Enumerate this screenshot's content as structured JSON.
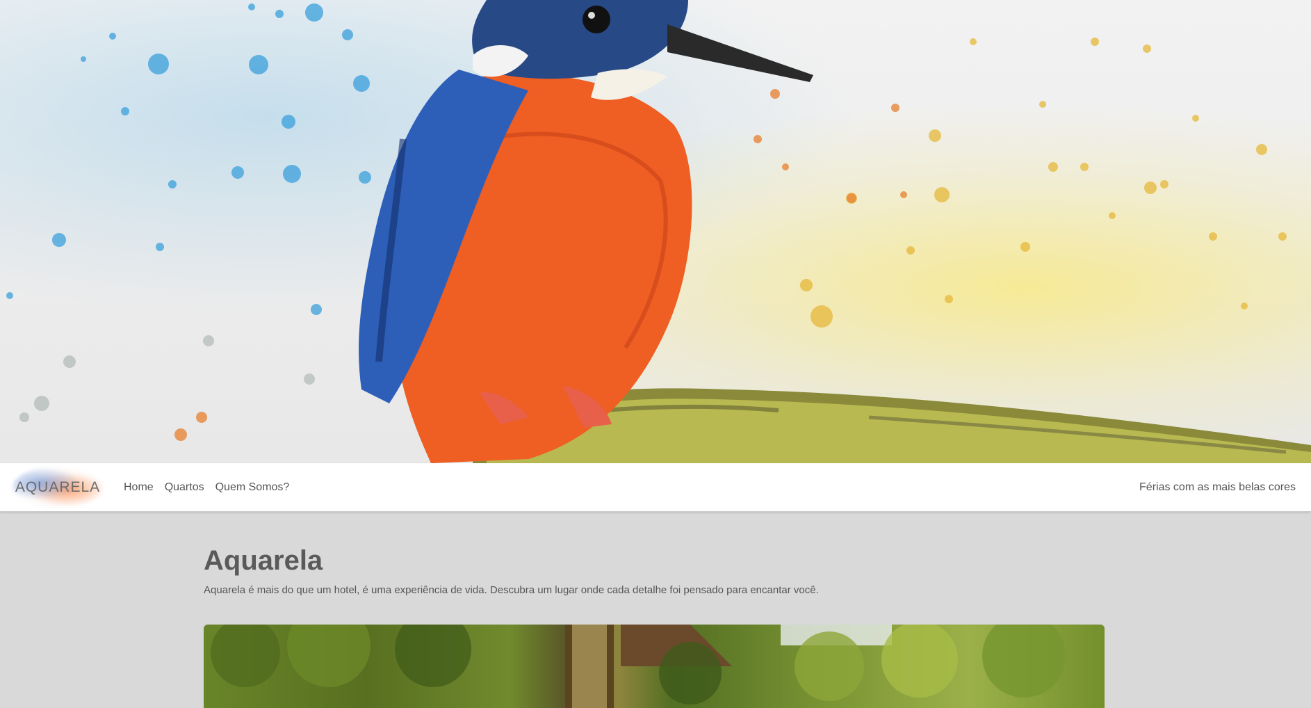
{
  "navbar": {
    "brand": "AQUARELA",
    "links": [
      {
        "label": "Home"
      },
      {
        "label": "Quartos"
      },
      {
        "label": "Quem Somos?"
      }
    ],
    "tagline": "Férias com as mais belas cores"
  },
  "main": {
    "title": "Aquarela",
    "lead": "Aquarela é mais do que um hotel, é uma experiência de vida. Descubra um lugar onde cada detalhe foi pensado para encantar você."
  },
  "colors": {
    "background": "#d9d9d9",
    "navbar": "#ffffff",
    "text": "#555555"
  }
}
